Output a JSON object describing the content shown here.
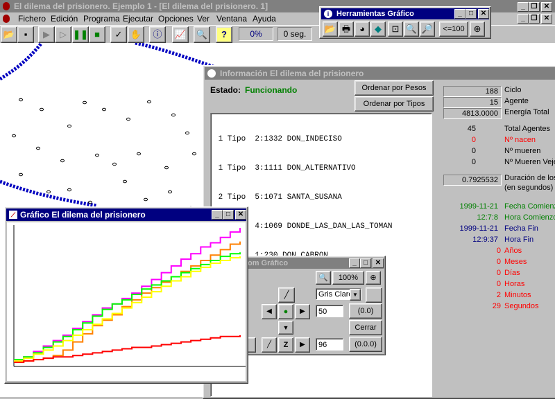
{
  "app": {
    "title": "El dilema del prisionero. Ejemplo 1 - [El dilema del prisionero. 1]"
  },
  "menu": [
    "Fichero",
    "Edición",
    "Programa",
    "Ejecutar",
    "Opciones",
    "Ver",
    "Ventana",
    "Ayuda"
  ],
  "toolbar": {
    "progress": "0%",
    "time": "0 seg."
  },
  "tools_window": {
    "title": "Herramientas Gráfico",
    "zoom_label": "<=100"
  },
  "info_window": {
    "title": "Información El dilema del prisionero",
    "estado_label": "Estado:",
    "estado_value": "Funcionando",
    "btn_pesos": "Ordenar por Pesos",
    "btn_tipos": "Ordenar por Tipos",
    "list": [
      " 1 Tipo  2:1332 DON_INDECISO",
      " 1 Tipo  3:1111 DON_ALTERNATIVO",
      " 2 Tipo  5:1071 SANTA_SUSANA",
      "40 Tipo  4:1069 DONDE_LAS_DAN_LAS_TOMAN",
      " 1 Tipo  1:230 DON_CABRON"
    ]
  },
  "stats": {
    "ciclo_value": "188",
    "ciclo_label": "Ciclo",
    "agente_value": "15",
    "agente_label": "Agente",
    "energia_value": "4813.0000",
    "energia_label": "Energía Total",
    "total_value": "45",
    "total_label": "Total Agentes",
    "nacen_value": "0",
    "nacen_label": "Nº nacen",
    "mueren_value": "0",
    "mueren_label": "Nº mueren",
    "vejez_value": "0",
    "vejez_label": "Nº Mueren Vejez",
    "duracion_value": "0.7925532",
    "duracion_label": "Duración de los",
    "duracion_label2": "(en segundos)",
    "fecha_comienzo_value": "1999-11-21",
    "fecha_comienzo_label": "Fecha Comienzo",
    "hora_comienzo_value": "12:7:8",
    "hora_comienzo_label": "Hora Comienzo",
    "fecha_fin_value": "1999-11-21",
    "fecha_fin_label": "Fecha Fin",
    "hora_fin_value": "12:9:37",
    "hora_fin_label": "Hora Fin",
    "anos_value": "0",
    "anos_label": "Años",
    "meses_value": "0",
    "meses_label": "Meses",
    "dias_value": "0",
    "dias_label": "Días",
    "horas_value": "0",
    "horas_label": "Horas",
    "minutos_value": "2",
    "minutos_label": "Minutos",
    "segundos_value": "29",
    "segundos_label": "Segundos",
    "colors": {
      "green": "#008000",
      "blue": "#000080",
      "red": "#ff0000"
    }
  },
  "zoom_window": {
    "title": "om Gráfico",
    "zoom_value": "100%",
    "color_select": "Gris Claro",
    "field1": "50",
    "field2": "96",
    "btn_00": "(0.0)",
    "btn_cerrar": "Cerrar",
    "btn_000": "(0.0.0)",
    "z_label": "Z"
  },
  "graph_window": {
    "title": "Gráfico El dilema del prisionero"
  },
  "chart_data": {
    "type": "line",
    "series": [
      {
        "color": "#ff00ff",
        "values": [
          2,
          5,
          9,
          13,
          17,
          21,
          26,
          31,
          36,
          41,
          44,
          48,
          52,
          57,
          62,
          67,
          72,
          77,
          81,
          86,
          89,
          93,
          97,
          100
        ]
      },
      {
        "color": "#ff8000",
        "values": [
          1,
          2,
          3,
          4,
          6,
          10,
          16,
          22,
          28,
          32,
          36,
          42,
          47,
          52,
          56,
          60,
          64,
          68,
          72,
          76,
          80,
          84,
          88,
          90
        ]
      },
      {
        "color": "#00ff00",
        "values": [
          3,
          5,
          8,
          12,
          16,
          20,
          25,
          30,
          35,
          40,
          44,
          47,
          51,
          55,
          58,
          61,
          64,
          67,
          70,
          73,
          76,
          79,
          81,
          82
        ]
      },
      {
        "color": "#ffff00",
        "values": [
          2,
          4,
          7,
          10,
          13,
          17,
          21,
          25,
          29,
          33,
          37,
          41,
          45,
          49,
          53,
          57,
          61,
          64,
          68,
          71,
          74,
          76,
          78,
          79
        ]
      },
      {
        "color": "#ff0000",
        "values": [
          1,
          2,
          3,
          4,
          5,
          5,
          6,
          7,
          8,
          9,
          10,
          11,
          12,
          12,
          13,
          14,
          15,
          16,
          17,
          18,
          19,
          20,
          20,
          21
        ]
      }
    ]
  },
  "world_dots": [
    [
      30,
      82
    ],
    [
      60,
      96
    ],
    [
      100,
      120
    ],
    [
      122,
      86
    ],
    [
      150,
      96
    ],
    [
      185,
      110
    ],
    [
      215,
      85
    ],
    [
      250,
      104
    ],
    [
      270,
      130
    ],
    [
      20,
      134
    ],
    [
      55,
      152
    ],
    [
      90,
      170
    ],
    [
      140,
      162
    ],
    [
      165,
      175
    ],
    [
      200,
      160
    ],
    [
      240,
      180
    ],
    [
      280,
      160
    ],
    [
      30,
      190
    ],
    [
      70,
      215
    ],
    [
      100,
      212
    ],
    [
      130,
      230
    ],
    [
      180,
      200
    ],
    [
      210,
      226
    ],
    [
      245,
      215
    ],
    [
      275,
      238
    ],
    [
      10,
      245
    ],
    [
      40,
      260
    ],
    [
      85,
      255
    ],
    [
      160,
      258
    ],
    [
      230,
      268
    ],
    [
      20,
      290
    ],
    [
      60,
      290
    ]
  ]
}
